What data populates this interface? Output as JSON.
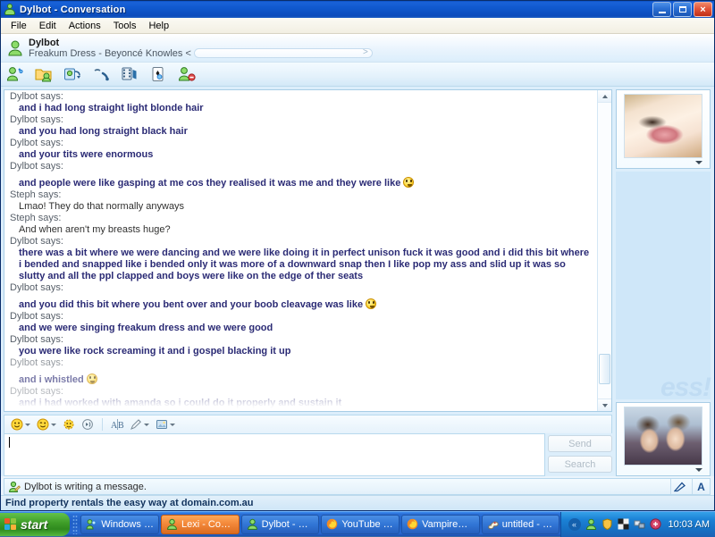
{
  "window": {
    "title": "Dylbot  - Conversation",
    "title_icon": "msn-contact-icon",
    "minimize_label": "",
    "maximize_label": "",
    "close_label": "×"
  },
  "menu": {
    "items": [
      {
        "label": "File"
      },
      {
        "label": "Edit"
      },
      {
        "label": "Actions"
      },
      {
        "label": "Tools"
      },
      {
        "label": "Help"
      }
    ]
  },
  "contact": {
    "name": "Dylbot",
    "personal_message": "Freakum Dress - Beyoncé Knowles <",
    "pill_arrow": ">"
  },
  "toolbar": {
    "buttons": [
      {
        "name": "invite-icon",
        "tip": "Invite"
      },
      {
        "name": "send-files-icon",
        "tip": "Send Files"
      },
      {
        "name": "video-call-icon",
        "tip": "Video"
      },
      {
        "name": "voice-call-icon",
        "tip": "Call"
      },
      {
        "name": "send-video-icon",
        "tip": "Send a single video message"
      },
      {
        "name": "activities-icon",
        "tip": "Activities"
      },
      {
        "name": "block-icon",
        "tip": "Block"
      }
    ]
  },
  "conversation": {
    "says_suffix": "says:",
    "messages": [
      {
        "sender": "Dylbot",
        "text": "and i had long straight light blonde hair",
        "style": "bold",
        "fade": 0,
        "gap": false
      },
      {
        "sender": "Dylbot",
        "text": "and you had long straight black hair",
        "style": "bold",
        "fade": 0,
        "gap": false
      },
      {
        "sender": "Dylbot",
        "text": "and your tits were enormous",
        "style": "bold",
        "fade": 0,
        "gap": false
      },
      {
        "sender": "Dylbot",
        "text": "and people were like gasping at me cos they realised it was me and they were like",
        "style": "bold",
        "fade": 0,
        "gap": true,
        "emoticon": "surprised-emoticon"
      },
      {
        "sender": "Steph",
        "text": "Lmao! They do that normally anyways",
        "style": "plain",
        "fade": 0,
        "gap": false
      },
      {
        "sender": "Steph",
        "text": "And when aren't my breasts huge?",
        "style": "plain",
        "fade": 0,
        "gap": false
      },
      {
        "sender": "Dylbot",
        "text": "there was a bit where we were dancing and we were like doing it in perfect unison fuck it was good and i did this bit where i bended and snapped like i bended only it was more of a downward snap then I like pop my ass and slid up it was so slutty and all the ppl clapped and boys were like on the edge of ther seats",
        "style": "bold",
        "fade": 0,
        "gap": false
      },
      {
        "sender": "Dylbot",
        "text": "and you did this bit where you bent over and your boob cleavage was like",
        "style": "bold",
        "fade": 0,
        "gap": true,
        "emoticon": "surprised-emoticon"
      },
      {
        "sender": "Dylbot",
        "text": "and we were singing freakum dress and we were good",
        "style": "bold",
        "fade": 0,
        "gap": false
      },
      {
        "sender": "Dylbot",
        "text": "you were like rock screaming it and i gospel blacking it up",
        "style": "bold",
        "fade": 0,
        "gap": false
      },
      {
        "sender": "Dylbot",
        "text": "and i whistled",
        "style": "bold",
        "fade": 1,
        "gap": true,
        "emoticon": "surprised-emoticon"
      },
      {
        "sender": "Dylbot",
        "text": "and i had worked with amanda so i could do it properly and sustain it",
        "style": "bold",
        "fade": 2,
        "gap": false
      }
    ]
  },
  "compose": {
    "toolbar": [
      {
        "name": "emoticon-icon",
        "has_caret": true
      },
      {
        "name": "wink-icon",
        "has_caret": true
      },
      {
        "name": "nudge-icon",
        "has_caret": false
      },
      {
        "name": "voice-clip-icon",
        "has_caret": false
      },
      {
        "name": "font-icon",
        "has_caret": false
      },
      {
        "name": "pen-color-icon",
        "has_caret": true
      },
      {
        "name": "backgrounds-icon",
        "has_caret": true
      }
    ],
    "input_value": "",
    "input_placeholder": "",
    "send_label": "Send",
    "search_label": "Search"
  },
  "status": {
    "text": "Dylbot is writing a message.",
    "icon": "writing-pencil-icon",
    "buttons": [
      {
        "name": "handwriting-icon",
        "label": "✓"
      },
      {
        "name": "text-mode-icon",
        "label": "A"
      }
    ]
  },
  "ad": {
    "text": "Find property rentals the easy way at domain.com.au"
  },
  "side_panel": {
    "contact_display_picture": "blonde-portrait-photo",
    "own_display_picture": "two-girls-photo",
    "collapse_arrow": "<"
  },
  "watermark": {
    "text": "ess!"
  },
  "taskbar": {
    "start_label": "start",
    "tasks": [
      {
        "label": "Windows Liv...",
        "icon": "windows-live-icon",
        "active": false,
        "flash": false
      },
      {
        "label": "Lexi - Conve...",
        "icon": "msn-contact-icon",
        "active": false,
        "flash": true
      },
      {
        "label": "Dylbot - Con...",
        "icon": "msn-contact-icon",
        "active": true,
        "flash": false
      },
      {
        "label": "YouTube - T...",
        "icon": "firefox-icon",
        "active": false,
        "flash": false
      },
      {
        "label": "VampireRav...",
        "icon": "firefox-icon",
        "active": false,
        "flash": false
      },
      {
        "label": "untitled - Paint",
        "icon": "paint-icon",
        "active": false,
        "flash": false
      }
    ],
    "tray": {
      "show_hidden_icons": "«",
      "icons": [
        {
          "name": "msn-messenger-tray-icon",
          "color": "#7ed957"
        },
        {
          "name": "shield-tray-icon",
          "color": "#f6c344"
        },
        {
          "name": "paint-tray-icon",
          "color": "#1f1f1f"
        },
        {
          "name": "network-tray-icon",
          "color": "#dfe8f2"
        },
        {
          "name": "antivirus-tray-icon",
          "color": "#d4456a"
        }
      ],
      "clock": "10:03 AM"
    }
  }
}
